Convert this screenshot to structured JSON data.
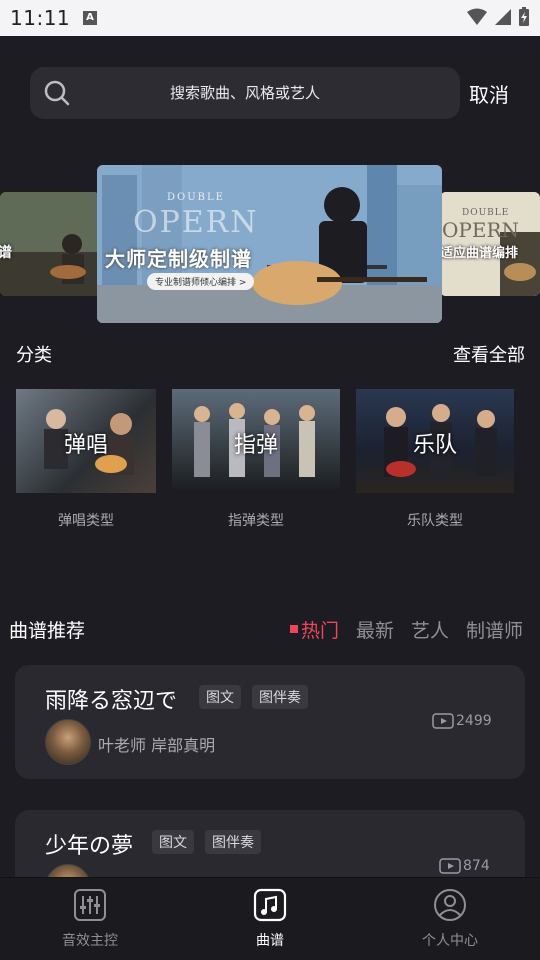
{
  "status_bar": {
    "time": "11:11",
    "indicator": "A"
  },
  "search": {
    "placeholder": "搜索歌曲、风格或艺人",
    "cancel_label": "取消"
  },
  "banners": {
    "main": {
      "brand_small": "DOUBLE",
      "brand": "OPERN",
      "title": "大师定制级制谱",
      "subtitle": "专业制谱师倾心编排 >"
    },
    "left": {
      "title": "谱"
    },
    "right": {
      "brand_small": "DOUBLE",
      "brand": "OPERN",
      "title": "适应曲谱编排"
    }
  },
  "category": {
    "title": "分类",
    "see_all": "查看全部",
    "items": [
      {
        "label": "弹唱",
        "caption": "弹唱类型"
      },
      {
        "label": "指弹",
        "caption": "指弹类型"
      },
      {
        "label": "乐队",
        "caption": "乐队类型"
      }
    ]
  },
  "recommend": {
    "title": "曲谱推荐",
    "tabs": [
      "热门",
      "最新",
      "艺人",
      "制谱师"
    ],
    "active_tab": "热门",
    "songs": [
      {
        "title": "雨降る窓辺で",
        "tags": [
          "图文",
          "图伴奏"
        ],
        "author": "叶老师  岸部真明",
        "plays": "2499"
      },
      {
        "title": "少年の夢",
        "tags": [
          "图文",
          "图伴奏"
        ],
        "author": "",
        "plays": "874"
      }
    ]
  },
  "nav": {
    "items": [
      {
        "label": "音效主控",
        "icon": "mixer-icon"
      },
      {
        "label": "曲谱",
        "icon": "music-score-icon"
      },
      {
        "label": "个人中心",
        "icon": "profile-icon"
      }
    ],
    "active": "曲谱"
  },
  "colors": {
    "accent": "#f0465c",
    "background": "#1d1c23",
    "card": "#2a2930"
  }
}
